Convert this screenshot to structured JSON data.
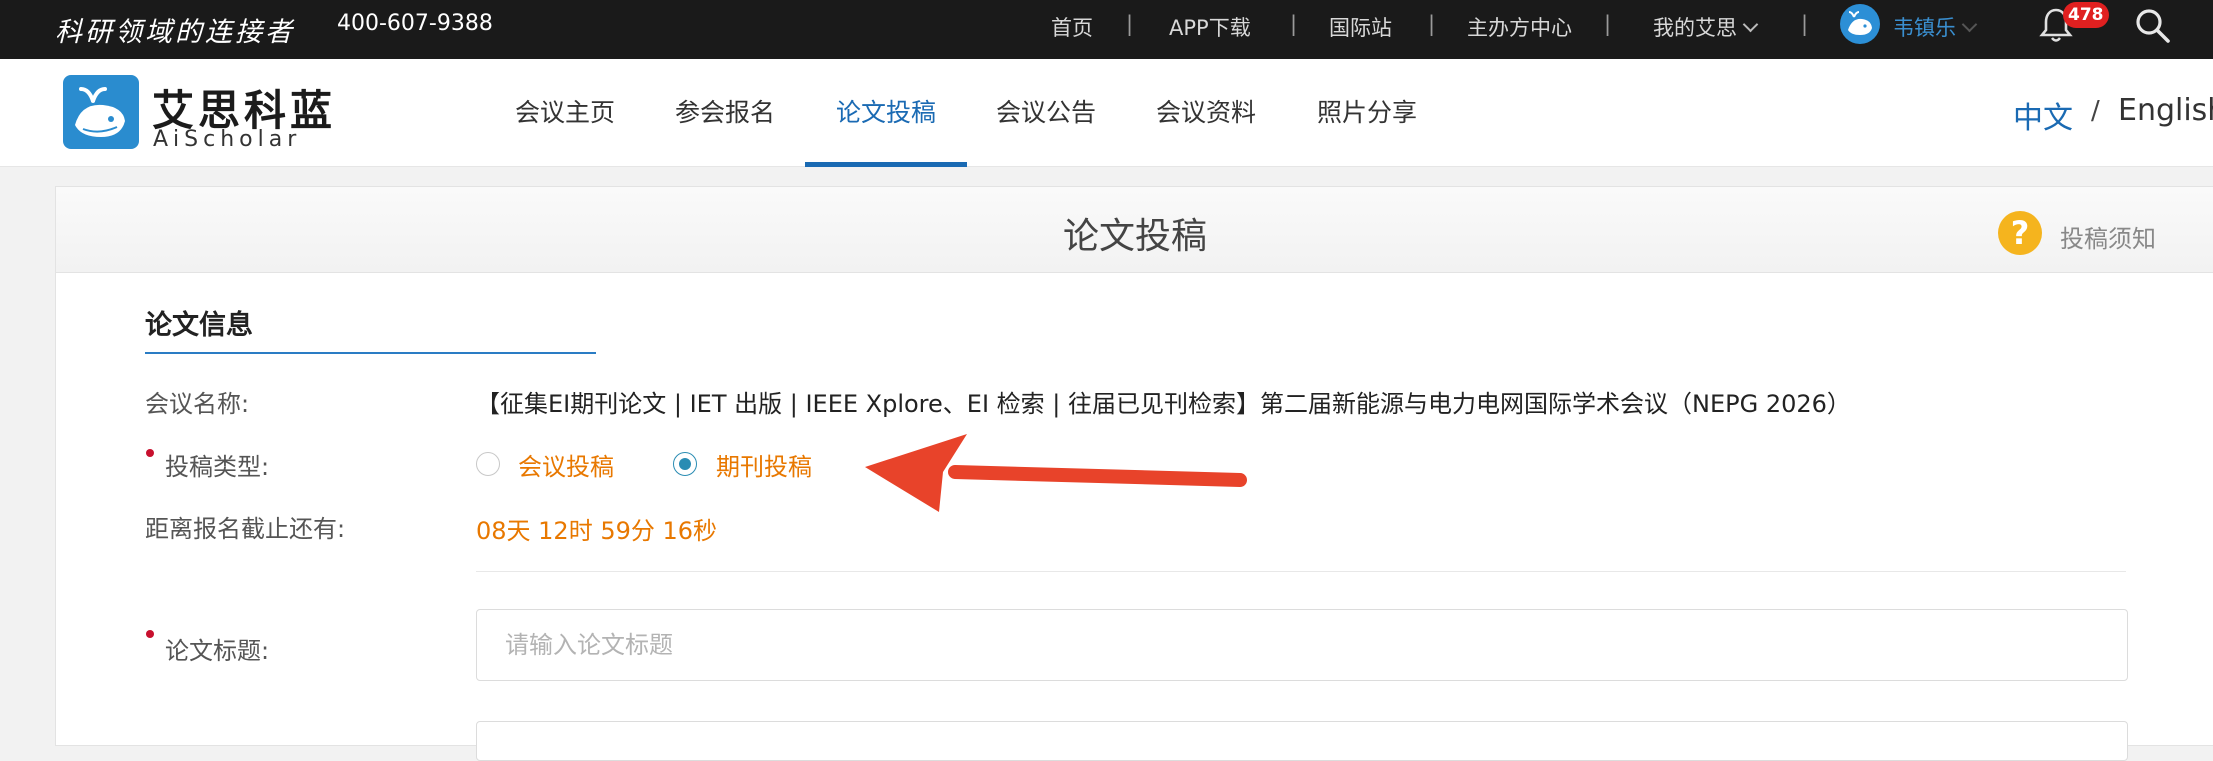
{
  "topbar": {
    "slogan": "科研领域的连接者",
    "hotline": "400-607-9388",
    "links": [
      "首页",
      "APP下载",
      "国际站",
      "主办方中心"
    ],
    "my_aisi": "我的艾思",
    "username": "韦镇乐",
    "notification_count": "478"
  },
  "header": {
    "logo_cn": "艾思科蓝",
    "logo_en": "AiScholar",
    "nav": [
      "会议主页",
      "参会报名",
      "论文投稿",
      "会议公告",
      "会议资料",
      "照片分享"
    ],
    "active_nav": "论文投稿",
    "lang_zh": "中文",
    "lang_sep": "/",
    "lang_en": "English"
  },
  "form": {
    "page_title": "论文投稿",
    "help_label": "投稿须知",
    "section_title": "论文信息",
    "conference_label": "会议名称:",
    "conference_name": "【征集EI期刊论文 | IET 出版 | IEEE Xplore、EI 检索 | 往届已见刊检索】第二届新能源与电力电网国际学术会议（NEPG 2026）",
    "type_label": "投稿类型:",
    "type_options": [
      "会议投稿",
      "期刊投稿"
    ],
    "type_selected": "期刊投稿",
    "deadline_label": "距离报名截止还有:",
    "countdown": "08天 12时 59分 16秒",
    "title_label": "论文标题:",
    "title_placeholder": "请输入论文标题"
  },
  "colors": {
    "accent_blue": "#1a6ab3",
    "orange": "#e87800",
    "required_red": "#c8102e",
    "annotation_arrow": "#e8432a"
  }
}
